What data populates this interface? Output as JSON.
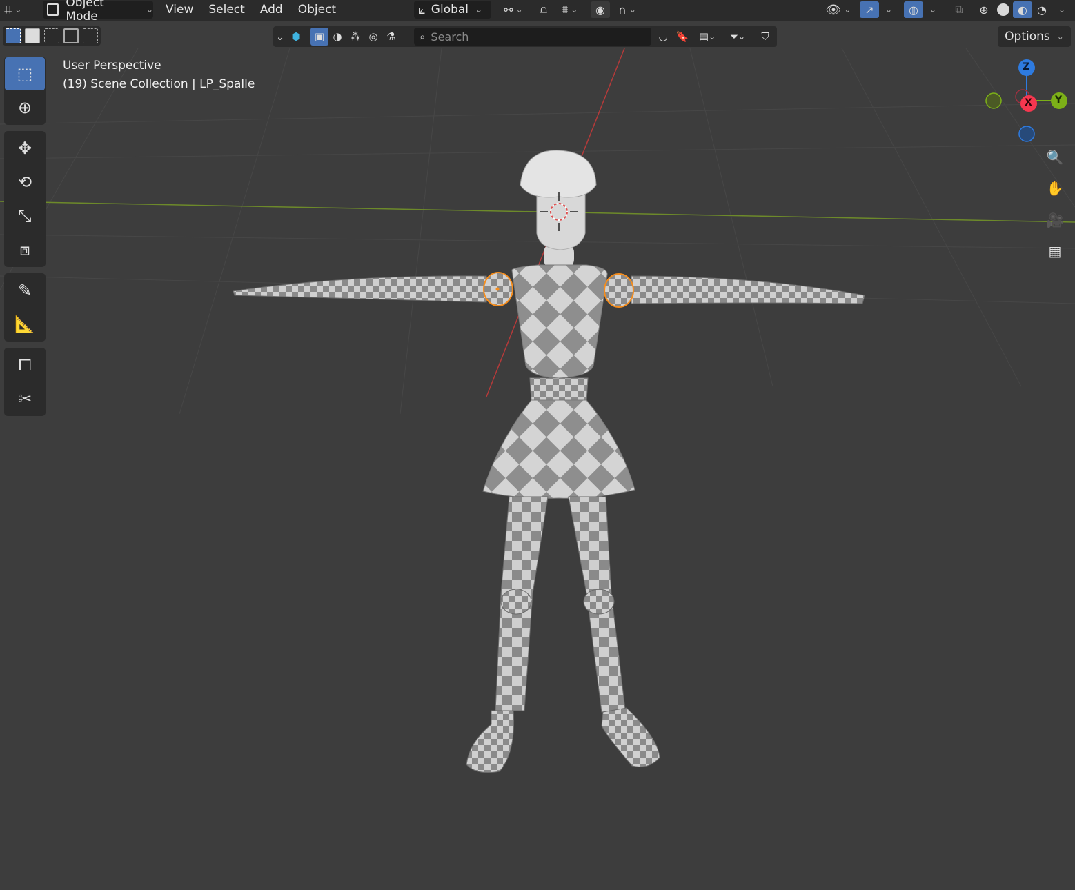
{
  "header": {
    "editor_type_icon": "3d-viewport-icon",
    "mode": "Object Mode",
    "menus": [
      "View",
      "Select",
      "Add",
      "Object"
    ],
    "orientation": "Global"
  },
  "toolbar2": {
    "search_placeholder": "Search",
    "options_label": "Options"
  },
  "viewport": {
    "perspective_label": "User Perspective",
    "collection_label": "(19) Scene Collection | LP_Spalle"
  },
  "gizmo": {
    "z_label": "Z",
    "x_label": "X",
    "y_label": "Y",
    "colors": {
      "x": "#f6374f",
      "y": "#7cb018",
      "z": "#2e7be0"
    }
  },
  "colors": {
    "accent": "#4772b3",
    "header_bg": "#2b2b2b",
    "viewport_bg": "#3d3d3d",
    "selection": "#f58d1d"
  }
}
